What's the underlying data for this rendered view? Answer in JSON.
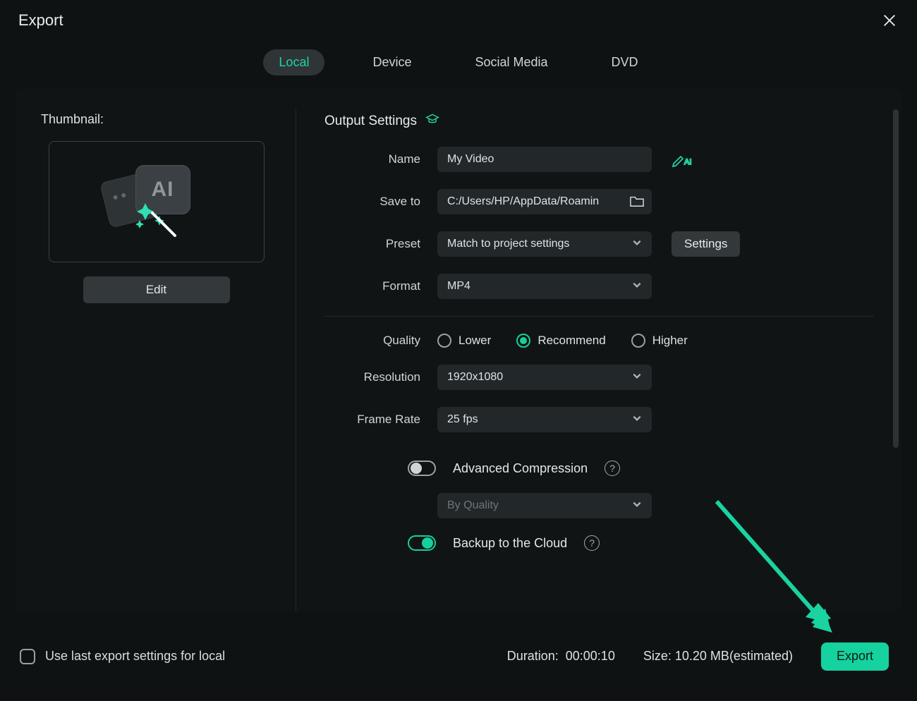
{
  "title": "Export",
  "tabs": [
    "Local",
    "Device",
    "Social Media",
    "DVD"
  ],
  "active_tab_index": 0,
  "thumbnail": {
    "label": "Thumbnail:",
    "edit": "Edit"
  },
  "output": {
    "section": "Output Settings",
    "name_label": "Name",
    "name_value": "My Video",
    "saveto_label": "Save to",
    "saveto_value": "C:/Users/HP/AppData/Roamin",
    "preset_label": "Preset",
    "preset_value": "Match to project settings",
    "settings_btn": "Settings",
    "format_label": "Format",
    "format_value": "MP4",
    "quality_label": "Quality",
    "quality_options": [
      "Lower",
      "Recommend",
      "Higher"
    ],
    "quality_selected_index": 1,
    "resolution_label": "Resolution",
    "resolution_value": "1920x1080",
    "framerate_label": "Frame Rate",
    "framerate_value": "25 fps",
    "advcomp_label": "Advanced Compression",
    "advcomp_on": false,
    "advcomp_mode": "By Quality",
    "backup_label": "Backup to the Cloud",
    "backup_on": true
  },
  "footer": {
    "uselast": "Use last export settings for local",
    "duration_label": "Duration:",
    "duration_value": "00:00:10",
    "size_label": "Size:",
    "size_value": "10.20 MB",
    "size_suffix": "(estimated)",
    "export_btn": "Export"
  }
}
